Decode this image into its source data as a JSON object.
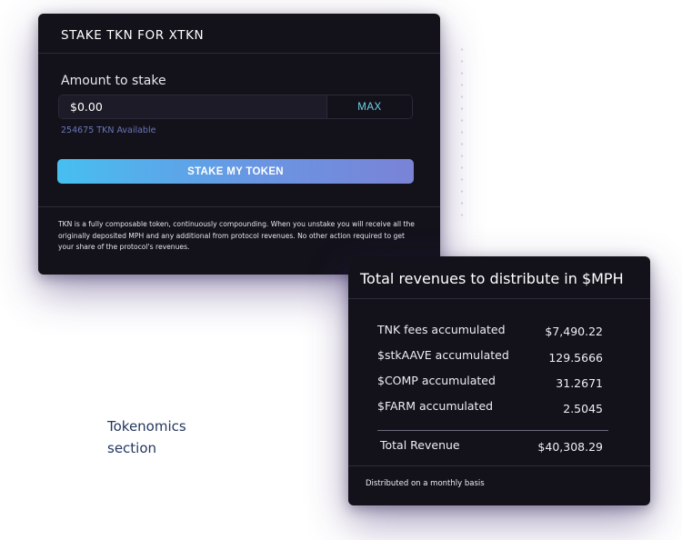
{
  "stake": {
    "title": "STAKE TKN FOR XTKN",
    "amount_label": "Amount to stake",
    "amount_value": "$0.00",
    "max_label": "MAX",
    "available": "254675 TKN Available",
    "button_label": "STAKE MY TOKEN",
    "description": "TKN is a fully composable token, continuously compounding. When you unstake you will receive all the originally deposited MPH and any additional from protocol revenues. No other action required to get your share of the protocol's revenues."
  },
  "revenues": {
    "title": "Total revenues to distribute in $MPH",
    "rows": [
      {
        "label": "TNK fees accumulated",
        "value": "$7,490.22"
      },
      {
        "label": "$stkAAVE accumulated",
        "value": "129.5666"
      },
      {
        "label": "$COMP accumulated",
        "value": "31.2671"
      },
      {
        "label": "$FARM accumulated",
        "value": "2.5045"
      }
    ],
    "total_label": "Total Revenue",
    "total_value": "$40,308.29",
    "footnote": "Distributed on a monthly basis"
  },
  "section": {
    "label": "Tokenomics section"
  },
  "colors": {
    "card_bg": "#13121b",
    "accent_cyan": "#6fd3e8",
    "gradient_start": "#47bff0",
    "gradient_end": "#7a83d6",
    "section_text": "#23375f"
  }
}
